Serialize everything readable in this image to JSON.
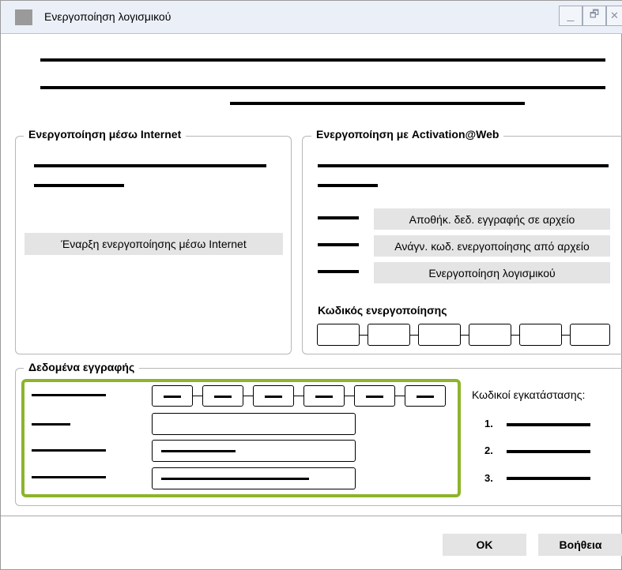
{
  "window": {
    "title": "Ενεργοποίηση λογισμικού",
    "controls": {
      "minimize": "_",
      "restore": "🗗",
      "close": "✕"
    }
  },
  "internet_group": {
    "legend": "Ενεργοποίηση μέσω Internet",
    "start_button": "Έναρξη ενεργοποίησης μέσω Internet"
  },
  "web_group": {
    "legend": "Ενεργοποίηση με Activation@Web",
    "save_button": "Αποθήκ. δεδ. εγγραφής σε αρχείο",
    "read_button": "Ανάγν. κωδ. ενεργοποίησης από αρχείο",
    "activate_button": "Ενεργοποίηση λογισμικού",
    "code_label": "Κωδικός ενεργοποίησης"
  },
  "registration_group": {
    "legend": "Δεδομένα εγγραφής",
    "install_codes_label": "Κωδικοί εγκατάστασης:",
    "install_codes": [
      "1.",
      "2.",
      "3."
    ]
  },
  "footer": {
    "ok_button": "OK",
    "help_button": "Βοήθεια"
  },
  "colors": {
    "highlight": "#8db42b",
    "titlebar": "#ebf0f8",
    "button": "#e4e4e4"
  }
}
